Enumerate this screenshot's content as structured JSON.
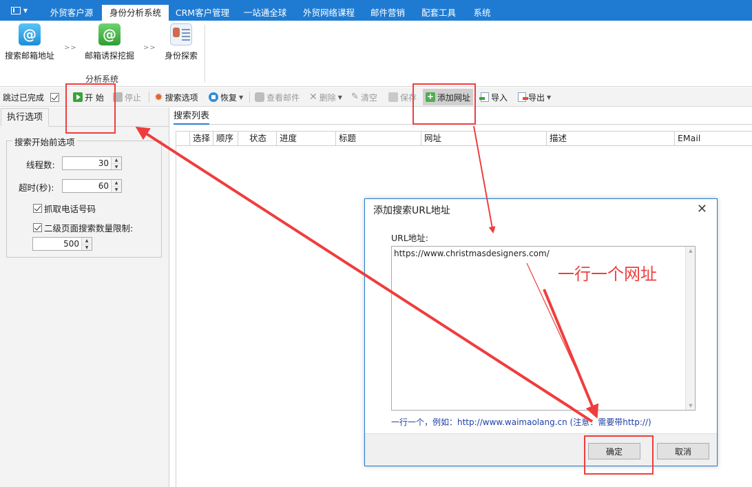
{
  "menubar": {
    "tabs": [
      {
        "label": "外贸客户源",
        "active": false
      },
      {
        "label": "身份分析系统",
        "active": true
      },
      {
        "label": "CRM客户管理",
        "active": false
      },
      {
        "label": "一站通全球",
        "active": false
      },
      {
        "label": "外贸网络课程",
        "active": false
      },
      {
        "label": "邮件营销",
        "active": false
      },
      {
        "label": "配套工具",
        "active": false
      },
      {
        "label": "系统",
        "active": false
      }
    ]
  },
  "ribbon": {
    "buttons": [
      {
        "label": "搜索邮箱地址",
        "icon": "mail-search-icon"
      },
      {
        "label": "邮箱诱探挖掘",
        "icon": "mail-mining-icon"
      },
      {
        "label": "身份探索",
        "icon": "id-card-icon"
      }
    ],
    "separator": ">>",
    "group_label": "分析系统"
  },
  "toolbar": {
    "skip_done_label": "跳过已完成",
    "skip_done_checked": true,
    "start_label": "开 始",
    "stop_label": "停止",
    "search_options_label": "搜索选项",
    "restore_label": "恢复",
    "view_mail_label": "查看邮件",
    "delete_label": "删除",
    "clear_label": "清空",
    "save_label": "保存",
    "add_url_label": "添加网址",
    "import_label": "导入",
    "export_label": "导出"
  },
  "left_panel": {
    "tab_label": "执行选项",
    "group_title": "搜索开始前选项",
    "threads_label": "线程数:",
    "threads_value": "30",
    "timeout_label": "超时(秒):",
    "timeout_value": "60",
    "capture_phone_label": "抓取电话号码",
    "capture_phone_checked": true,
    "second_level_limit_label": "二级页面搜索数量限制:",
    "second_level_limit_checked": true,
    "second_level_limit_value": "500"
  },
  "main": {
    "tab_label": "搜索列表",
    "columns": [
      "选择",
      "顺序",
      "状态",
      "进度",
      "标题",
      "网址",
      "描述",
      "EMail"
    ]
  },
  "dialog": {
    "title": "添加搜索URL地址",
    "url_label": "URL地址:",
    "url_value": "https://www.christmasdesigners.com/",
    "hint": "一行一个，例如：http://www.waimaolang.cn (注意：需要带http://)",
    "ok_label": "确定",
    "cancel_label": "取消"
  },
  "annotation": {
    "note": "一行一个网址",
    "color": "#ef3d3d"
  },
  "colors": {
    "menubar_bg": "#1f7bd2",
    "toolbar_bg": "#f3f3f3",
    "hint_text": "#1f3fa5"
  }
}
